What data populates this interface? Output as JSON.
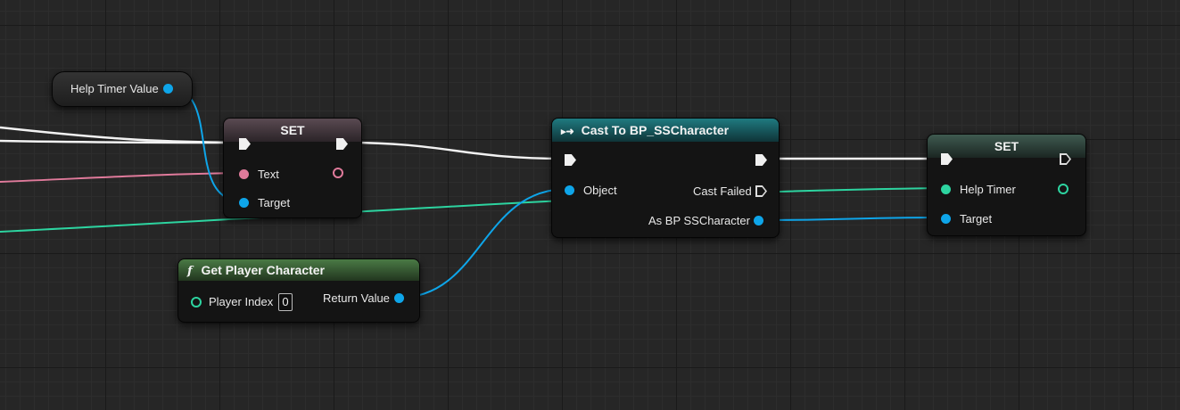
{
  "colors": {
    "background": "#262626",
    "exec_wire": "#ffffff",
    "object_pin": "#0ea5e9",
    "text_pin": "#e07a9b",
    "float_pin": "#2dd4a0",
    "pure_header": "#4a7a45",
    "cast_header": "#1a6a6e"
  },
  "nodes": {
    "help_timer_value": {
      "label": "Help Timer Value"
    },
    "set_text": {
      "title": "SET",
      "text_pin": "Text",
      "target_pin": "Target"
    },
    "get_player_character": {
      "icon": "f",
      "title": "Get Player Character",
      "player_index_label": "Player Index",
      "player_index_value": "0",
      "return_label": "Return Value"
    },
    "cast": {
      "icon": "▸➜",
      "title": "Cast To BP_SSCharacter",
      "object_pin": "Object",
      "cast_failed_pin": "Cast Failed",
      "as_pin": "As BP SSCharacter"
    },
    "set_help_timer": {
      "title": "SET",
      "help_timer_pin": "Help Timer",
      "target_pin": "Target"
    }
  }
}
